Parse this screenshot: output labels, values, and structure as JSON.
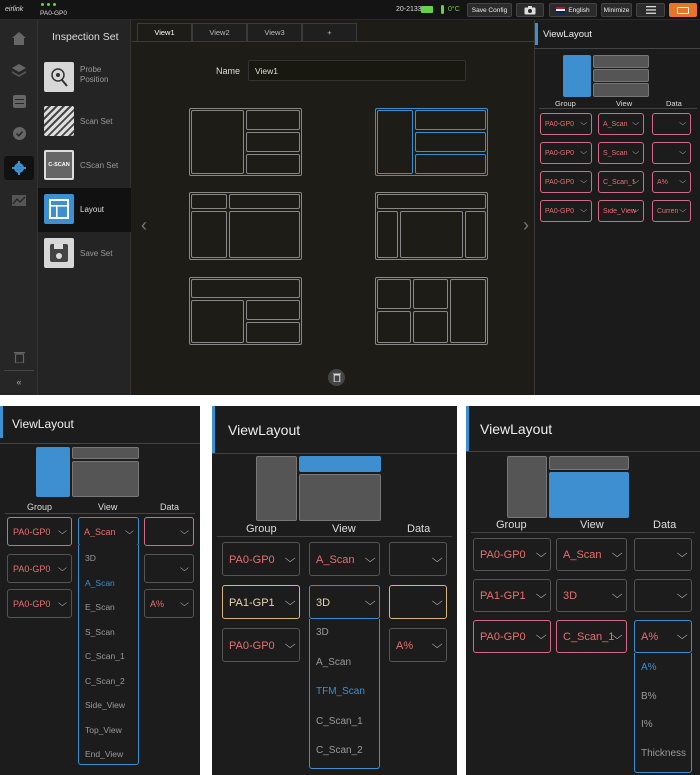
{
  "app": {
    "logo": "eirlink",
    "group_label": "PA0-GP0",
    "serial": "20-2133SA",
    "temperature": "0°C",
    "save_config": "Save Config",
    "language": "English",
    "minimize": "Minimize"
  },
  "menu": {
    "title": "Inspection Set",
    "items": [
      {
        "label": "Probe Position"
      },
      {
        "label": "Scan Set"
      },
      {
        "label": "CScan Set",
        "icon_text": "C-SCAN"
      },
      {
        "label": "Layout"
      },
      {
        "label": "Save Set"
      }
    ]
  },
  "tabs": [
    "View1",
    "View2",
    "View3",
    "+"
  ],
  "name_field": {
    "label": "Name",
    "value": "View1"
  },
  "view_layout": {
    "title": "ViewLayout",
    "headers": {
      "group": "Group",
      "view": "View",
      "data": "Data"
    },
    "rows": [
      {
        "group": "PA0-GP0",
        "view": "A_Scan",
        "data": ""
      },
      {
        "group": "PA0-GP0",
        "view": "S_Scan",
        "data": ""
      },
      {
        "group": "PA0-GP0",
        "view": "C_Scan_1",
        "data": "A%"
      },
      {
        "group": "PA0-GP0",
        "view": "Side_View",
        "data": "Curren"
      }
    ]
  },
  "zoom1": {
    "title": "ViewLayout",
    "rows": [
      {
        "group": "PA0-GP0",
        "view": "A_Scan"
      },
      {
        "group": "PA0-GP0"
      },
      {
        "group": "PA0-GP0",
        "data": "A%"
      }
    ],
    "options": [
      "3D",
      "A_Scan",
      "E_Scan",
      "S_Scan",
      "C_Scan_1",
      "C_Scan_2",
      "Side_View",
      "Top_View",
      "End_View"
    ],
    "active": "A_Scan"
  },
  "zoom2": {
    "title": "ViewLayout",
    "rows": [
      {
        "group": "PA0-GP0",
        "view": "A_Scan"
      },
      {
        "group": "PA1-GP1",
        "view": "3D"
      },
      {
        "group": "PA0-GP0",
        "data": "A%"
      }
    ],
    "options": [
      "3D",
      "A_Scan",
      "TFM_Scan",
      "C_Scan_1",
      "C_Scan_2"
    ],
    "active": "TFM_Scan"
  },
  "zoom3": {
    "title": "ViewLayout",
    "rows": [
      {
        "group": "PA0-GP0",
        "view": "A_Scan"
      },
      {
        "group": "PA1-GP1",
        "view": "3D"
      },
      {
        "group": "PA0-GP0",
        "view": "C_Scan_1",
        "data": "A%"
      }
    ],
    "options": [
      "A%",
      "B%",
      "I%",
      "Thickness"
    ],
    "active": "A%"
  },
  "colors": {
    "accent": "#3e8fd0",
    "pink": "#e86f6f",
    "gold": "#d8b77e",
    "battery": "#e8742a"
  }
}
